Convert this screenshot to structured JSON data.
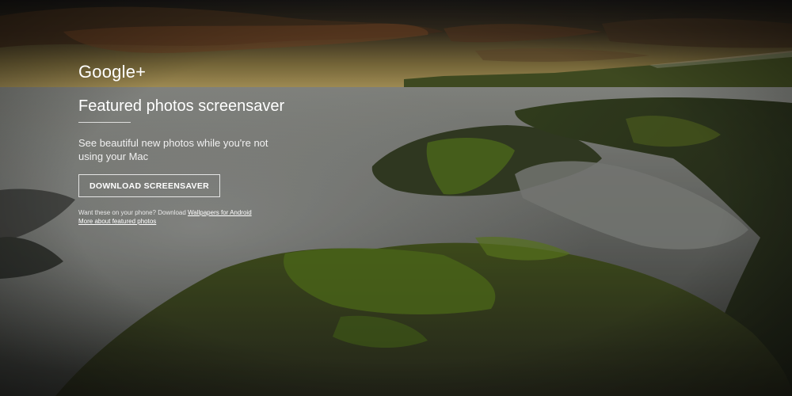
{
  "brand": {
    "logo_text": "Google+"
  },
  "hero": {
    "title": "Featured photos screensaver",
    "subtitle": "See beautiful new photos while you're not using your Mac"
  },
  "actions": {
    "download_label": "DOWNLOAD SCREENSAVER"
  },
  "footer_links": {
    "phone_prefix": "Want these on your phone? Download ",
    "android_link_label": "Wallpapers for Android",
    "more_link_label": "More about featured photos"
  },
  "colors": {
    "text": "#ffffff",
    "sky_warm": "#c9a04a",
    "sky_dark": "#2a2418",
    "water": "#8a8d88",
    "moss": "#5c7a1e",
    "rock": "#3a3a30"
  }
}
